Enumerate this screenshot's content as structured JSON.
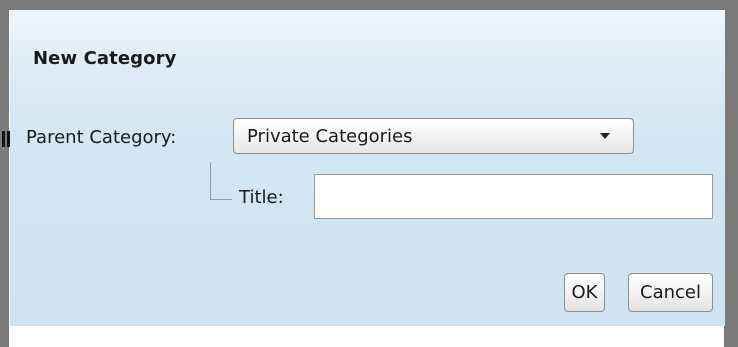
{
  "dialog": {
    "title": "New Category",
    "parent_label": "Parent Category:",
    "parent_selected": "Private Categories",
    "title_label": "Title:",
    "title_value": "",
    "ok_label": "OK",
    "cancel_label": "Cancel"
  },
  "icons": {
    "dropdown": "chevron-down-icon",
    "grip": "drag-grip-icon"
  },
  "colors": {
    "dialog_bg_top": "#eef6fc",
    "dialog_bg_bottom": "#cfe3f2",
    "frame": "#7a7a7a"
  }
}
